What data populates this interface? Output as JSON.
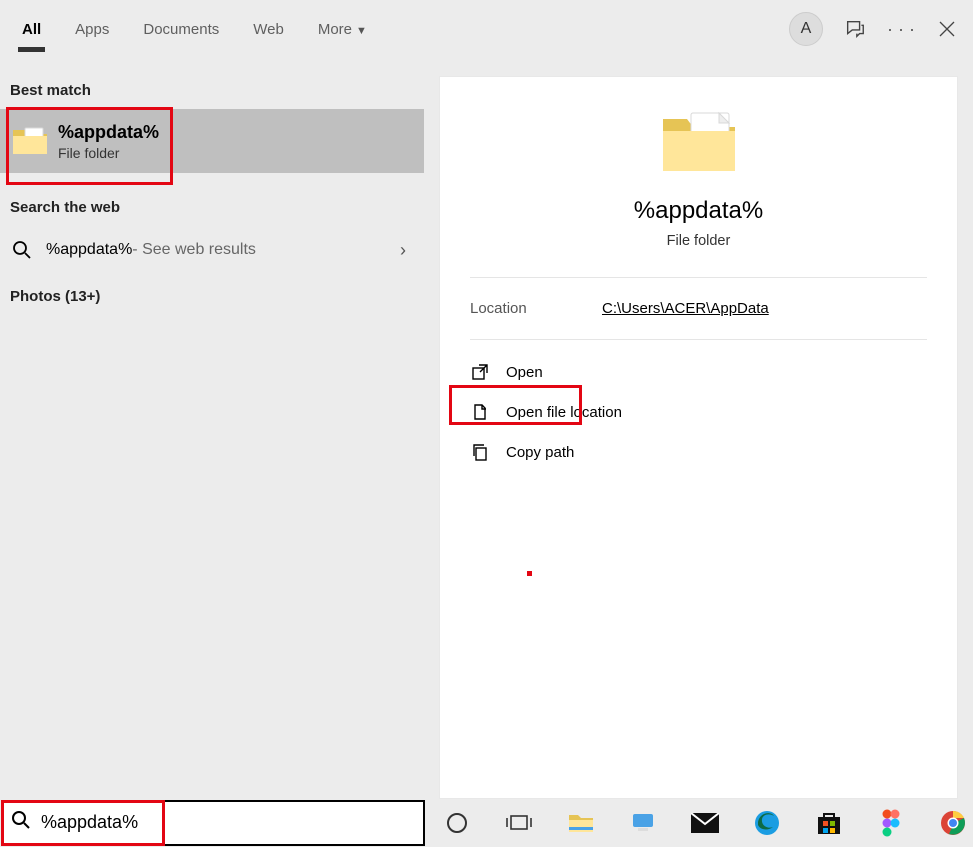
{
  "header": {
    "tabs": [
      "All",
      "Apps",
      "Documents",
      "Web",
      "More"
    ],
    "avatar_initial": "A"
  },
  "left": {
    "best_match_label": "Best match",
    "best_match": {
      "title": "%appdata%",
      "subtitle": "File folder"
    },
    "search_web_label": "Search the web",
    "web_result": {
      "query": "%appdata%",
      "suffix": " - See web results"
    },
    "photos_label": "Photos (13+)"
  },
  "right": {
    "title": "%appdata%",
    "subtitle": "File folder",
    "location_label": "Location",
    "location_path": "C:\\Users\\ACER\\AppData",
    "actions": {
      "open": "Open",
      "open_loc": "Open file location",
      "copy_path": "Copy path"
    }
  },
  "searchbar": {
    "value": "%appdata%"
  }
}
